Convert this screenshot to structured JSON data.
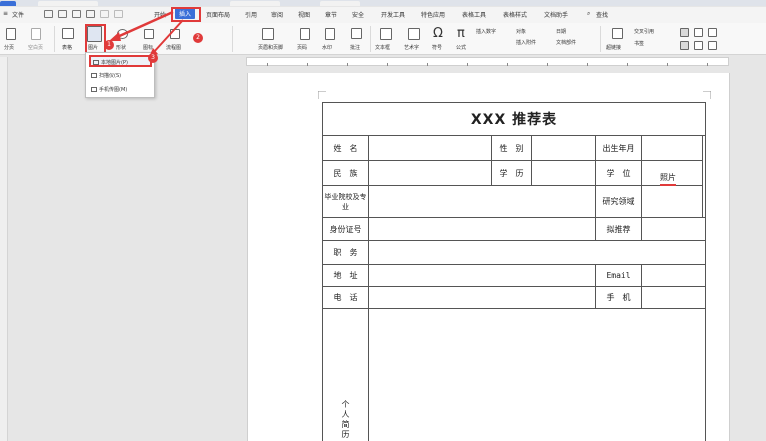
{
  "menubar": {
    "file": "文件",
    "tabs": [
      "开始",
      "插入",
      "页面布局",
      "引用",
      "审阅",
      "视图",
      "章节",
      "安全",
      "开发工具",
      "特色应用",
      "表格工具",
      "表格样式",
      "文档助手"
    ],
    "active_tab": "插入",
    "search": "查找"
  },
  "ribbon": {
    "items": [
      "分页",
      "空白页",
      "表格",
      "图片",
      "形状",
      "图标",
      "流程图",
      "页眉和页脚",
      "页码",
      "水印",
      "批注",
      "文本框",
      "艺术字",
      "符号",
      "公式",
      "插入数字",
      "插入附件",
      "对象",
      "文档部件",
      "日期",
      "超链接",
      "交叉引用",
      "书签"
    ]
  },
  "dropdown": {
    "items": [
      "本地图片(P)",
      "扫描仪(S)",
      "手机传图(M)"
    ]
  },
  "badges": [
    "1",
    "2",
    "3"
  ],
  "form": {
    "title": "XXX 推荐表",
    "name": "姓　名",
    "gender": "性　别",
    "birth": "出生年月",
    "ethnicity": "民　族",
    "education": "学　历",
    "degree": "学　位",
    "photo": "照片",
    "school": "毕业院校及专业",
    "research": "研究领域",
    "id_number": "身份证号",
    "recommend": "拟推荐",
    "position": "职　务",
    "address": "地　址",
    "email": "Email",
    "phone": "电　话",
    "mobile": "手　机",
    "resume": "个人简历"
  },
  "colors": {
    "accent": "#3a6fd8",
    "annotation": "#e03a3a"
  }
}
